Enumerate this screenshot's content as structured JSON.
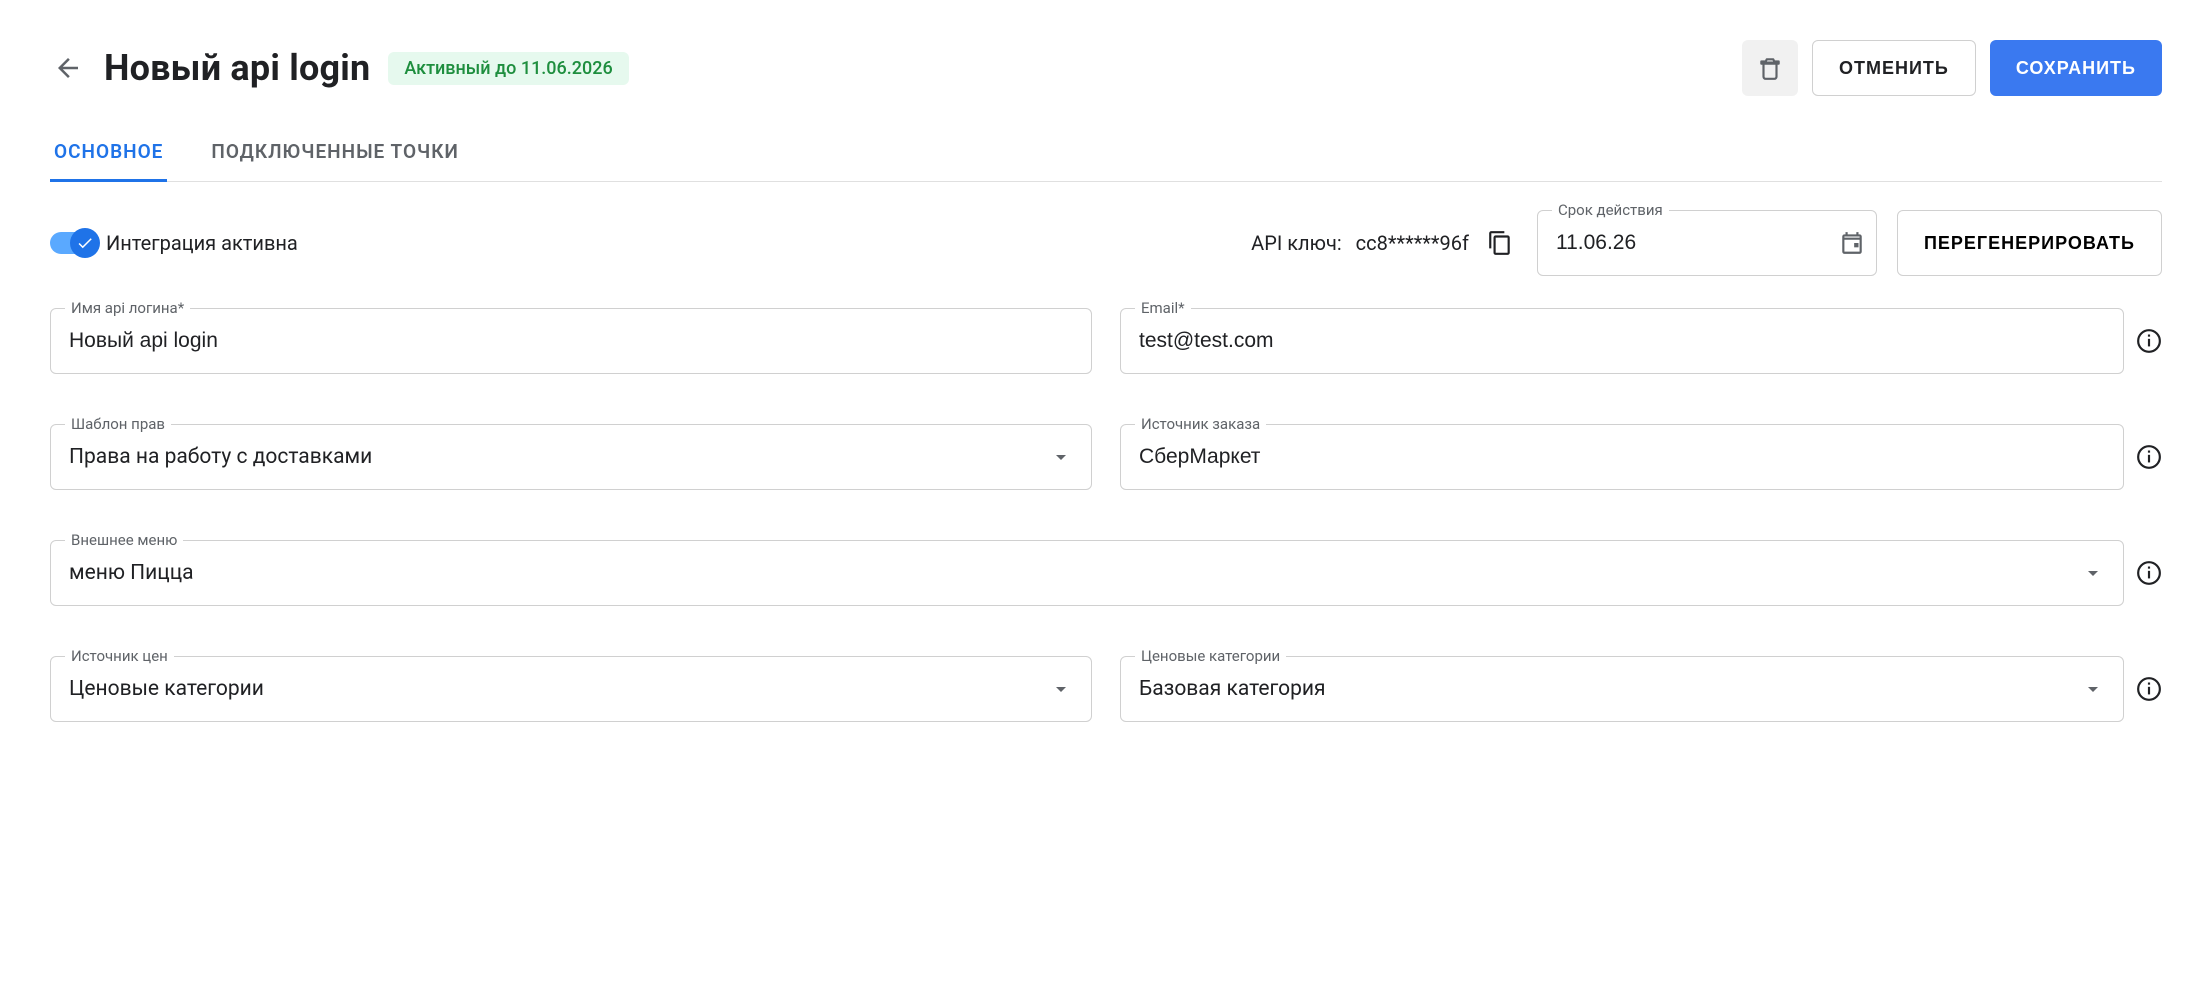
{
  "header": {
    "title": "Новый api login",
    "status": "Активный до 11.06.2026",
    "cancel": "ОТМЕНИТЬ",
    "save": "СОХРАНИТЬ"
  },
  "tabs": {
    "main": "ОСНОВНОЕ",
    "points": "ПОДКЛЮЧЕННЫЕ ТОЧКИ"
  },
  "integration": {
    "toggle_label": "Интеграция активна",
    "api_key_label": "API ключ:",
    "api_key_value": "cc8******96f",
    "expiry_label": "Срок действия",
    "expiry_value": "11.06.26",
    "regenerate": "ПЕРЕГЕНЕРИРОВАТЬ"
  },
  "fields": {
    "login_name_label": "Имя api логина*",
    "login_name_value": "Новый api login",
    "email_label": "Email*",
    "email_value": "test@test.com",
    "perm_template_label": "Шаблон прав",
    "perm_template_value": "Права на работу с доставками",
    "order_source_label": "Источник заказа",
    "order_source_value": "СберМаркет",
    "external_menu_label": "Внешнее меню",
    "external_menu_value": "меню Пицца",
    "price_source_label": "Источник цен",
    "price_source_value": "Ценовые категории",
    "price_categories_label": "Ценовые категории",
    "price_categories_value": "Базовая категория"
  }
}
